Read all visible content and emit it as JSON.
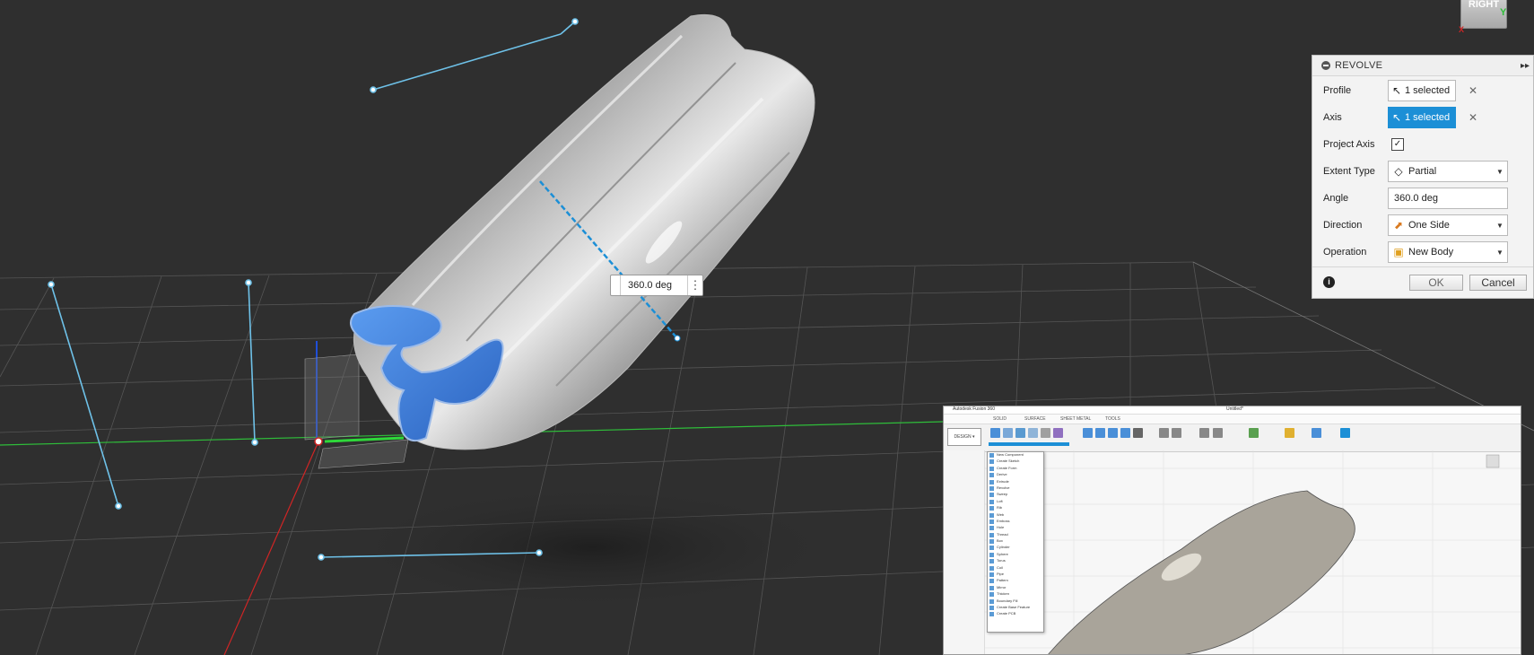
{
  "viewcube": {
    "face_label": "RIGHT",
    "y_axis": "Y",
    "x_axis": "X"
  },
  "canvas": {
    "angle_input": {
      "value": "360.0 deg",
      "more_icon": "vertical-ellipsis-icon"
    }
  },
  "revolve_dialog": {
    "title": "REVOLVE",
    "collapse_icon": "minus-circle-icon",
    "expand_icon": "double-chevron-right-icon",
    "fields": {
      "profile": {
        "label": "Profile",
        "value": "1 selected",
        "icon": "cursor-arrow-icon"
      },
      "axis": {
        "label": "Axis",
        "value": "1 selected",
        "icon": "cursor-arrow-icon",
        "active": true
      },
      "project_axis": {
        "label": "Project Axis",
        "checked": true,
        "mark": "✓"
      },
      "extent_type": {
        "label": "Extent Type",
        "value": "Partial",
        "icon": "partial-extent-icon"
      },
      "angle": {
        "label": "Angle",
        "value": "360.0 deg"
      },
      "direction": {
        "label": "Direction",
        "value": "One Side",
        "icon": "one-side-direction-icon"
      },
      "operation": {
        "label": "Operation",
        "value": "New Body",
        "icon": "new-body-icon"
      }
    },
    "info_icon": "i",
    "ok_label": "OK",
    "cancel_label": "Cancel"
  },
  "colors": {
    "background": "#2f2f2f",
    "accent": "#1c8fd6",
    "sketch_line": "#6ec1e8",
    "profile_fill": "#3a7ed6",
    "x_axis": "#d02525",
    "y_axis": "#2fbd3a",
    "z_axis": "#1f4fd8"
  },
  "pip": {
    "title": "Autodesk Fusion 360",
    "center_title": "Untitled*",
    "tabs": [
      "SOLID",
      "SURFACE",
      "SHEET METAL",
      "TOOLS"
    ],
    "design_label": "DESIGN ▾",
    "menu_items": [
      "New Component",
      "Create Sketch",
      "Create Form",
      "Derive",
      "Extrude",
      "Revolve",
      "Sweep",
      "Loft",
      "Rib",
      "Web",
      "Emboss",
      "Hole",
      "Thread",
      "Box",
      "Cylinder",
      "Sphere",
      "Torus",
      "Coil",
      "Pipe",
      "Pattern",
      "Mirror",
      "Thicken",
      "Boundary Fill",
      "Create Base Feature",
      "Create PCB"
    ]
  }
}
